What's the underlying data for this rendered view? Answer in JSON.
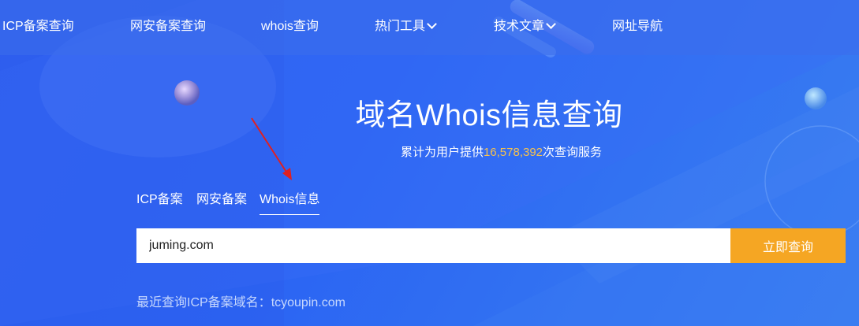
{
  "nav": {
    "items": [
      {
        "label": "ICP备案查询"
      },
      {
        "label": "网安备案查询"
      },
      {
        "label": "whois查询"
      },
      {
        "label": "热门工具"
      },
      {
        "label": "技术文章"
      },
      {
        "label": "网址导航"
      }
    ]
  },
  "hero": {
    "title": "域名Whois信息查询",
    "subtitle_prefix": "累计为用户提供",
    "subtitle_count": "16,578,392",
    "subtitle_suffix": "次查询服务"
  },
  "tabs": [
    {
      "label": "ICP备案"
    },
    {
      "label": "网安备案"
    },
    {
      "label": "Whois信息",
      "active": true
    }
  ],
  "search": {
    "value": "juming.com",
    "button_label": "立即查询"
  },
  "recent": {
    "label": "最近查询ICP备案域名：",
    "domain": "tcyoupin.com"
  },
  "colors": {
    "background": "#2f5ff0",
    "accent_button": "#f5a623",
    "count_highlight": "#f7c24d",
    "annotation_arrow": "#e02020"
  },
  "icons": [
    "chevron-down-icon",
    "annotation-arrow-icon"
  ]
}
